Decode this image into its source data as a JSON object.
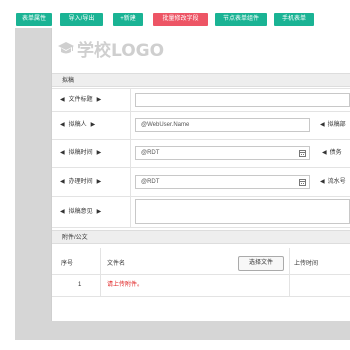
{
  "toolbar": {
    "buttons": [
      {
        "label": "表单属性",
        "color": "#1ab394"
      },
      {
        "label": "导入/导出",
        "color": "#1ab394"
      },
      {
        "label": "+新建",
        "color": "#1ab394"
      },
      {
        "label": "批量修改字段",
        "color": "#ed5565"
      },
      {
        "label": "节点表单组件",
        "color": "#1ab394"
      },
      {
        "label": "手机表单",
        "color": "#1ab394"
      }
    ]
  },
  "logo": {
    "text": "学校LOGO",
    "icon": "graduation-cap-icon"
  },
  "draft_section": {
    "title": "拟稿"
  },
  "fields": {
    "doc_title": {
      "label": "文件标题",
      "value": ""
    },
    "drafter": {
      "label": "拟稿人",
      "value": "@WebUser.Name"
    },
    "draft_time": {
      "label": "拟稿时间",
      "value": "@RDT"
    },
    "process_time": {
      "label": "办理时间",
      "value": "@RDT"
    },
    "draft_opinion": {
      "label": "拟稿意见",
      "value": ""
    }
  },
  "right_labels": {
    "drafter_dept": "拟稿部",
    "notes": "债务",
    "serial": "流水号"
  },
  "attachments": {
    "title": "附件/公文",
    "columns": {
      "seq": "序号",
      "filename": "文件名",
      "upload_time": "上传时间"
    },
    "upload_button": "选择文件",
    "rows": [
      {
        "seq": "1",
        "filename": "请上传附件。"
      }
    ]
  },
  "colors": {
    "accent_green": "#1ab394",
    "accent_red": "#ed5565",
    "error_text": "#e02020"
  }
}
